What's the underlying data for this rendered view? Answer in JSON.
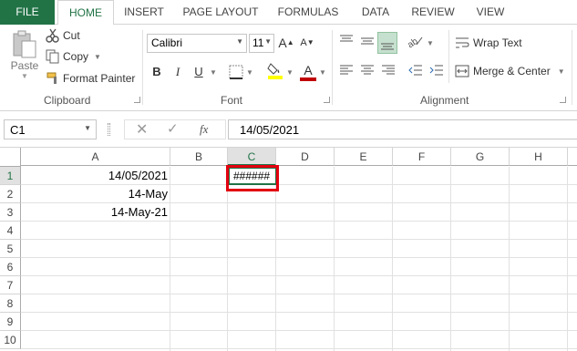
{
  "tabs": [
    "FILE",
    "HOME",
    "INSERT",
    "PAGE LAYOUT",
    "FORMULAS",
    "DATA",
    "REVIEW",
    "VIEW"
  ],
  "clipboard": {
    "paste": "Paste",
    "cut": "Cut",
    "copy": "Copy",
    "format_painter": "Format Painter",
    "label": "Clipboard"
  },
  "font": {
    "name": "Calibri",
    "size": "11",
    "bold": "B",
    "italic": "I",
    "underline": "U",
    "grow": "A",
    "shrink": "A",
    "color_letter": "A",
    "label": "Font"
  },
  "alignment": {
    "wrap": "Wrap Text",
    "merge": "Merge & Center",
    "label": "Alignment"
  },
  "formula_bar": {
    "name_box": "C1",
    "fx": "fx",
    "value": "14/05/2021"
  },
  "columns": [
    "A",
    "B",
    "C",
    "D",
    "E",
    "F",
    "G",
    "H"
  ],
  "rows": [
    "1",
    "2",
    "3",
    "4",
    "5",
    "6",
    "7",
    "8",
    "9",
    "10"
  ],
  "cells": {
    "A1": "14/05/2021",
    "A2": "14-May",
    "A3": "14-May-21",
    "C1": "######"
  },
  "colors": {
    "brand": "#217346",
    "highlight": "#e3000f",
    "font_color": "#c00000",
    "fill_color": "#ffff00"
  }
}
